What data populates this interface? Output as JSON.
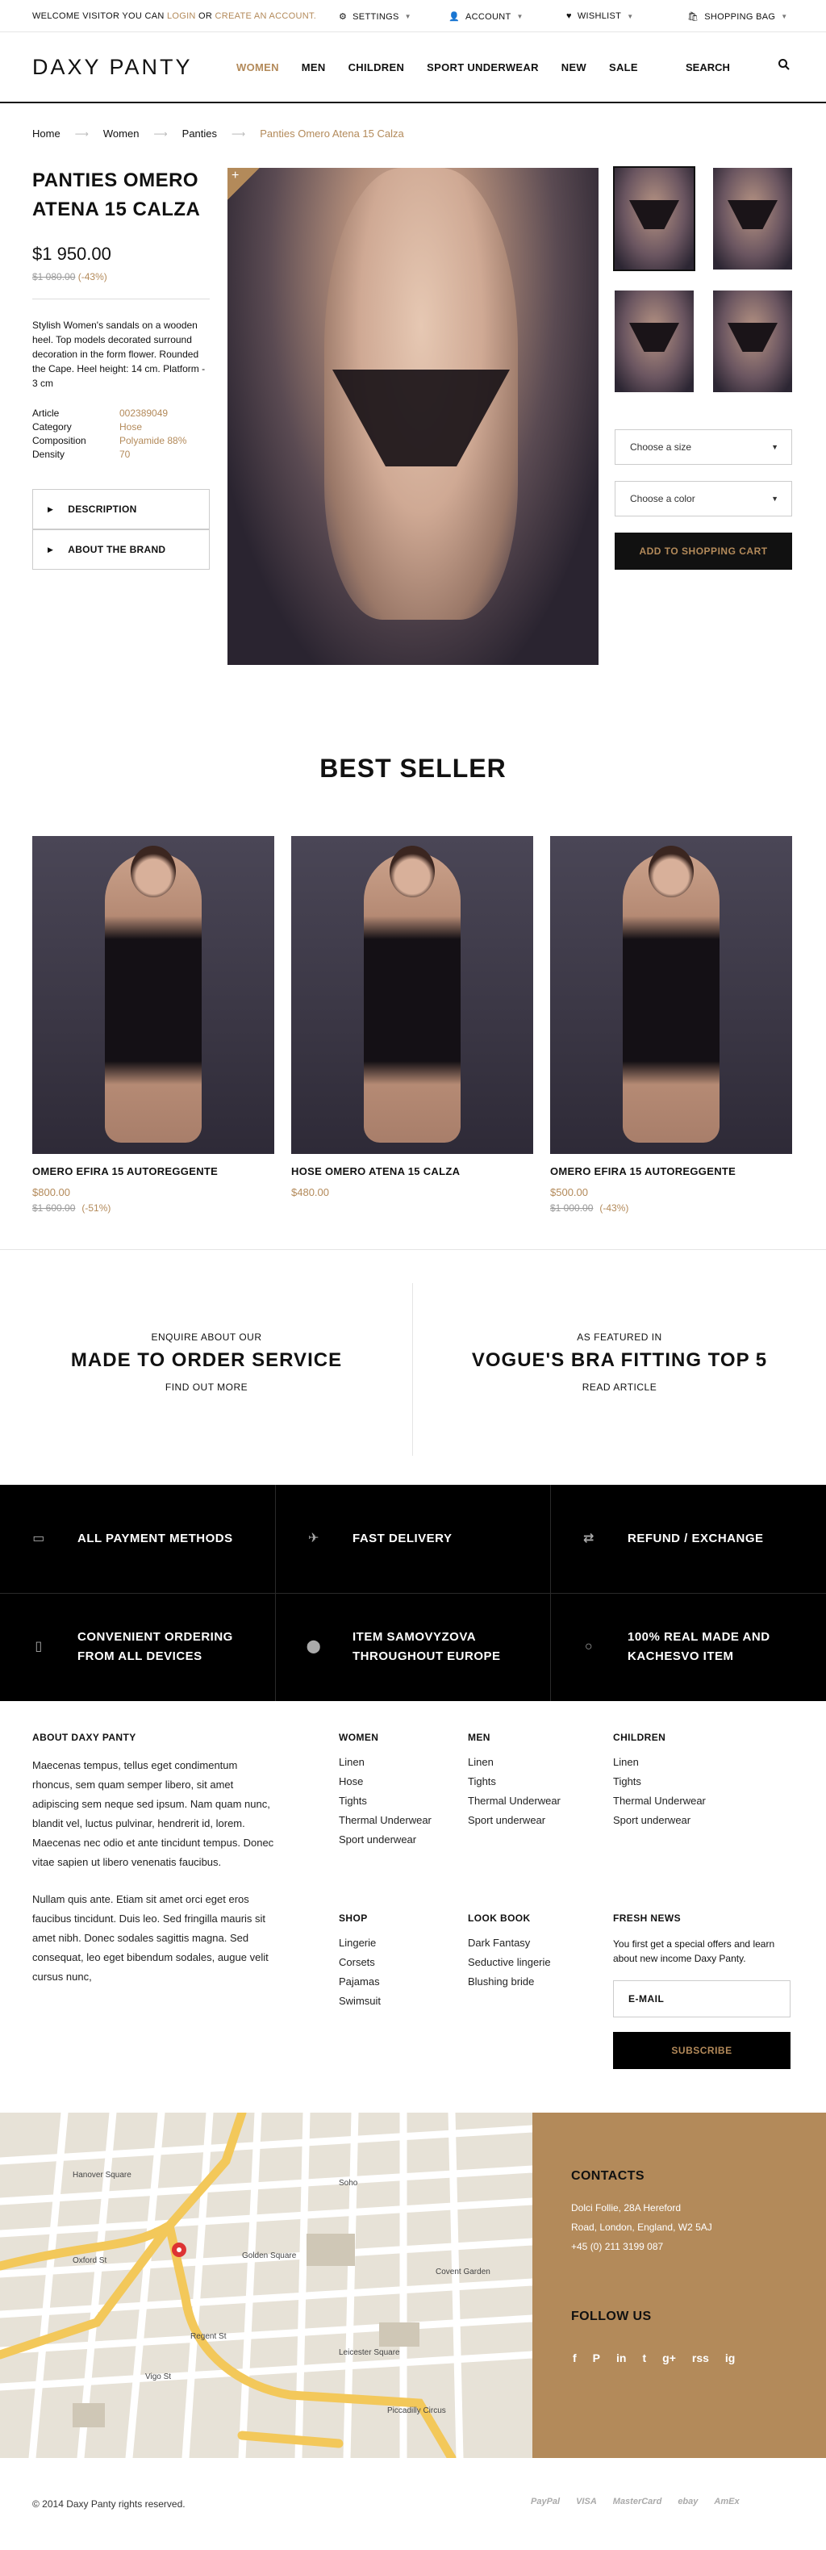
{
  "topbar": {
    "welcome_text": "WELCOME VISITOR YOU CAN",
    "login": "LOGIN",
    "or": "OR",
    "create_account": "CREATE AN ACCOUNT.",
    "settings": "SETTINGS",
    "account": "ACCOUNT",
    "wishlist": "WISHLIST",
    "shopping_bag": "SHOPPING BAG"
  },
  "header": {
    "logo": "DAXY PANTY",
    "nav": [
      "WOMEN",
      "MEN",
      "CHILDREN",
      "SPORT UNDERWEAR",
      "NEW",
      "SALE"
    ],
    "search": "SEARCH"
  },
  "breadcrumb": [
    "Home",
    "Women",
    "Panties",
    "Panties Omero Atena 15 Calza"
  ],
  "product": {
    "title": "PANTIES OMERO ATENA 15 CALZA",
    "price": "$1 950.00",
    "old_price": "$1 080.00",
    "discount": "(-43%)",
    "description": "Stylish Women's sandals on a wooden heel. Top models decorated surround decoration in the form flower. Rounded the Cape. Heel height: 14 cm. Platform - 3 cm",
    "specs": [
      {
        "k": "Article",
        "v": "002389049"
      },
      {
        "k": "Category",
        "v": "Hose"
      },
      {
        "k": "Composition",
        "v": "Polyamide 88%"
      },
      {
        "k": "Density",
        "v": "70"
      }
    ],
    "accordion": [
      "DESCRIPTION",
      "ABOUT THE BRAND"
    ],
    "size_placeholder": "Choose a size",
    "color_placeholder": "Choose a color",
    "cart_button": "ADD TO SHOPPING CART",
    "plus": "+"
  },
  "best_seller": {
    "title": "BEST SELLER",
    "items": [
      {
        "name": "OMERO EFIRA 15 AUTOREGGENTE",
        "price": "$800.00",
        "old": "$1 600.00",
        "disc": "(-51%)"
      },
      {
        "name": "HOSE OMERO ATENA 15 CALZA",
        "price": "$480.00",
        "old": "",
        "disc": ""
      },
      {
        "name": "OMERO EFIRA 15 AUTOREGGENTE",
        "price": "$500.00",
        "old": "$1 000.00",
        "disc": "(-43%)"
      }
    ]
  },
  "promos": [
    {
      "small": "ENQUIRE ABOUT OUR",
      "big": "MADE TO ORDER SERVICE",
      "link": "FIND OUT MORE"
    },
    {
      "small": "AS FEATURED IN",
      "big": "VOGUE'S BRA FITTING TOP 5",
      "link": "READ ARTICLE"
    }
  ],
  "features": [
    {
      "label": "ALL PAYMENT METHODS",
      "icon": "card-icon"
    },
    {
      "label": "FAST DELIVERY",
      "icon": "plane-icon"
    },
    {
      "label": "REFUND / EXCHANGE",
      "icon": "exchange-icon"
    },
    {
      "label": "CONVENIENT ORDERING FROM ALL DEVICES",
      "icon": "phone-icon"
    },
    {
      "label": "ITEM SAMOVYZOVA THROUGHOUT EUROPE",
      "icon": "pin-icon"
    },
    {
      "label": "100% REAL MADE AND KACHESVO ITEM",
      "icon": "circle-icon"
    }
  ],
  "footer": {
    "about_title": "ABOUT DAXY PANTY",
    "about_p1": "Maecenas tempus, tellus eget condimentum rhoncus, sem quam semper libero, sit amet adipiscing sem neque sed ipsum. Nam quam nunc, blandit vel, luctus pulvinar, hendrerit id, lorem. Maecenas nec odio et ante tincidunt tempus. Donec vitae sapien ut libero venenatis faucibus.",
    "about_p2": "Nullam quis ante. Etiam sit amet orci eget eros faucibus tincidunt. Duis leo. Sed fringilla mauris sit amet nibh. Donec sodales sagittis magna. Sed consequat, leo eget bibendum sodales, augue velit cursus nunc,",
    "women": {
      "title": "WOMEN",
      "items": [
        "Linen",
        "Hose",
        "Tights",
        "Thermal Underwear",
        "Sport underwear"
      ]
    },
    "men": {
      "title": "MEN",
      "items": [
        "Linen",
        "Tights",
        "Thermal Underwear",
        "Sport underwear"
      ]
    },
    "children": {
      "title": "CHILDREN",
      "items": [
        "Linen",
        "Tights",
        "Thermal Underwear",
        "Sport underwear"
      ]
    },
    "shop": {
      "title": "SHOP",
      "items": [
        "Lingerie",
        "Corsets",
        "Pajamas",
        "Swimsuit"
      ]
    },
    "lookbook": {
      "title": "LOOK BOOK",
      "items": [
        "Dark Fantasy",
        "Seductive lingerie",
        "Blushing bride"
      ]
    },
    "fresh": {
      "title": "FRESH NEWS",
      "text": "You first get a special offers and learn about new income Daxy Panty.",
      "email_placeholder": "E-MAIL",
      "subscribe": "SUBSCRIBE"
    }
  },
  "contacts": {
    "title": "CONTACTS",
    "line1": "Dolci Follie, 28A Hereford",
    "line2": "Road, London, England, W2 5AJ",
    "phone": "+45 (0) 211 3199 087",
    "follow": "FOLLOW US",
    "social": [
      "f",
      "P",
      "in",
      "t",
      "g+",
      "rss",
      "ig"
    ]
  },
  "map": {
    "labels": [
      "Oxford St",
      "Regent St",
      "Piccadilly Circus",
      "Soho",
      "Covent Garden",
      "Leicester Square",
      "Hanover Square",
      "Golden Square",
      "Vigo St"
    ]
  },
  "bottom": {
    "copyright": "© 2014 Daxy Panty rights reserved.",
    "payments": [
      "PayPal",
      "VISA",
      "MasterCard",
      "ebay",
      "AmEx"
    ]
  },
  "colors": {
    "accent": "#b38a5a",
    "dark": "#000000"
  }
}
